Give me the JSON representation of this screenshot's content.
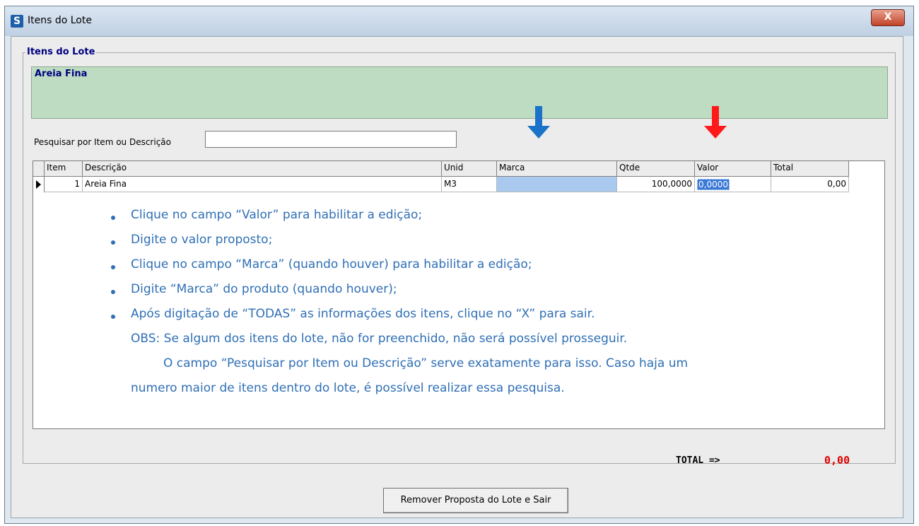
{
  "window": {
    "title": "Itens do Lote",
    "close_label": "X"
  },
  "group": {
    "label": "Itens do Lote",
    "description": "Areia Fina"
  },
  "search": {
    "label": "Pesquisar por Item ou Descrição",
    "value": ""
  },
  "grid": {
    "columns": [
      "Item",
      "Descrição",
      "Unid",
      "Marca",
      "Qtde",
      "Valor",
      "Total"
    ],
    "rows": [
      {
        "item": "1",
        "descricao": "Areia Fina",
        "unid": "M3",
        "marca": "",
        "qtde": "100,0000",
        "valor": "0,0000",
        "total": "0,00"
      }
    ]
  },
  "instructions": {
    "bullets": [
      "Clique no campo “Valor” para habilitar a edição;",
      "Digite o valor proposto;",
      "Clique no campo “Marca” (quando houver) para habilitar a edição;",
      "Digite “Marca” do produto (quando houver);",
      "Após digitação de “TODAS” as informações dos itens, clique no “X” para sair."
    ],
    "obs": "OBS: Se algum dos itens do lote, não for preenchido, não será possível prosseguir.",
    "obs_line2": "O campo “Pesquisar por Item ou Descrição” serve exatamente para isso. Caso haja um",
    "obs_line3": "numero maior de itens dentro do lote, é possível realizar essa pesquisa."
  },
  "totals": {
    "label": "TOTAL =>",
    "value": "0,00"
  },
  "buttons": {
    "remove": "Remover Proposta do Lote e Sair"
  },
  "colors": {
    "blue_arrow": "#1a73c8",
    "red_arrow": "#ff1a1a",
    "total_value": "#e00000",
    "instruction_text": "#2f6fb5"
  },
  "icons": [
    "app-icon",
    "close-icon",
    "row-indicator-icon",
    "down-arrow-icon"
  ]
}
